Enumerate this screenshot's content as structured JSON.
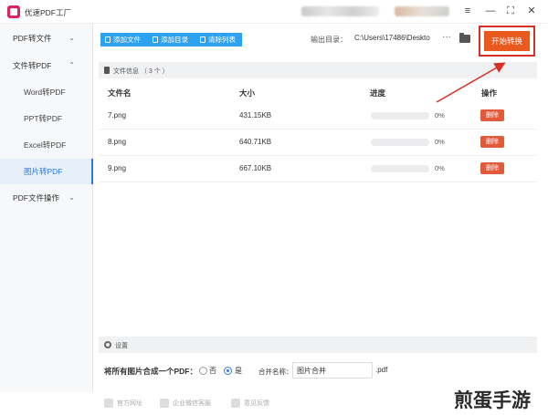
{
  "app": {
    "title": "优速PDF工厂"
  },
  "window_controls": {
    "menu": "≡",
    "minimize": "—",
    "maximize": "⛶",
    "close": "✕"
  },
  "sidebar": {
    "items": [
      {
        "label": "PDF转文件",
        "chevron": "⌄"
      },
      {
        "label": "文件转PDF",
        "chevron": "⌃"
      },
      {
        "label": "Word转PDF"
      },
      {
        "label": "PPT转PDF"
      },
      {
        "label": "Excel转PDF"
      },
      {
        "label": "图片转PDF"
      },
      {
        "label": "PDF文件操作",
        "chevron": "⌄"
      }
    ],
    "active": "图片转PDF"
  },
  "toolbar": {
    "add_file": "添加文件",
    "add_folder": "添加目录",
    "clear_list": "清除列表",
    "output_label": "输出目录：",
    "output_path": "C:\\Users\\17486\\Deskto",
    "more": "···",
    "start": "开始转换"
  },
  "file_panel": {
    "header": "文件信息 （ 3 个 ）",
    "columns": [
      "文件名",
      "大小",
      "进度",
      "操作"
    ],
    "rows": [
      {
        "name": "7.png",
        "size": "431.15KB",
        "progress": 0,
        "progress_text": "0%",
        "action": "删除"
      },
      {
        "name": "8.png",
        "size": "640.71KB",
        "progress": 0,
        "progress_text": "0%",
        "action": "删除"
      },
      {
        "name": "9.png",
        "size": "667.10KB",
        "progress": 0,
        "progress_text": "0%",
        "action": "删除"
      }
    ]
  },
  "settings": {
    "header": "设置",
    "merge_label": "将所有图片合成一个PDF：",
    "option_no": "否",
    "option_yes": "是",
    "selected": "是",
    "name_label": "合并名称：",
    "name_value": "图片合并",
    "ext": ".pdf"
  },
  "footer": {
    "official_site": "官方网址",
    "enterprise": "企业微信客服",
    "feedback": "意见反馈"
  },
  "watermark": "煎蛋手游",
  "colors": {
    "accent": "#2ea2f0",
    "start_button": "#ea5a1f",
    "delete_button": "#e05a3b",
    "highlight": "#d93025"
  }
}
